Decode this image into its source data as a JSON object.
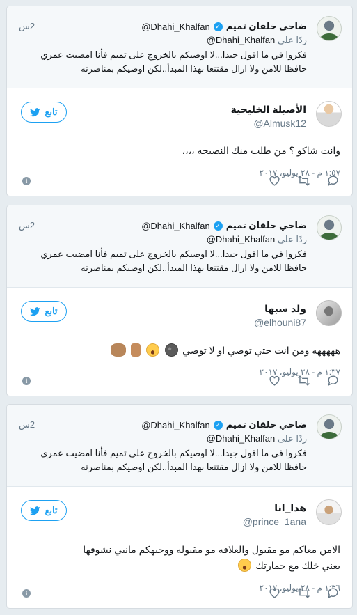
{
  "quoted": {
    "name": "ضاحي خلفان تميم",
    "handle": "@Dhahi_Khalfan",
    "time": "2س",
    "reply_prefix": "ردًا على",
    "reply_handle": "@Dhahi_Khalfan",
    "text": "فكروا في ما اقول جيدا...لا اوصيكم بالخروج على تميم فأنا امضيت عمري حافظا للامن ولا ازال مقتنعا بهذا المبدأ..لكن اوصيكم بمناصرته"
  },
  "follow_label": "تابع",
  "tweets": [
    {
      "name": "الأصيلة الخليجية",
      "handle": "@Almusk12",
      "text": "وانت شاكو ؟ من طلب منك النصيحه ،،،،",
      "timestamp": "١:٥٧ م - ٢٨ يوليو، ٢٠١٧"
    },
    {
      "name": "ولد سبها",
      "handle": "@elhouni87",
      "text": "هههههه ومن انت حتي توصي او لا توصي",
      "timestamp": "١:٣٧ م - ٢٨ يوليو، ٢٠١٧",
      "emojis": [
        "new-moon-face",
        "face-with-tears-of-joy",
        "point-down",
        "waving-hands"
      ]
    },
    {
      "name": "هذا_انا",
      "handle": "@prince_1ana",
      "text_line1": "الامن معاكم مو مقبول والعلاقه مو مقبوله ووجيهكم مانبي نشوفها",
      "text_line2": "يعني خلك مع حمارتك",
      "timestamp": "١:٣٦ م - ٢٨ يوليو، ٢٠١٧",
      "emojis": [
        "face-with-tears-of-joy"
      ]
    }
  ],
  "icons": {
    "reply": "reply-icon",
    "retweet": "retweet-icon",
    "like": "heart-icon",
    "info": "info-icon",
    "verified": "verified-badge-icon",
    "bird": "twitter-bird-icon"
  },
  "colors": {
    "accent": "#1da1f2",
    "muted": "#657786",
    "background": "#e6ecf0"
  }
}
